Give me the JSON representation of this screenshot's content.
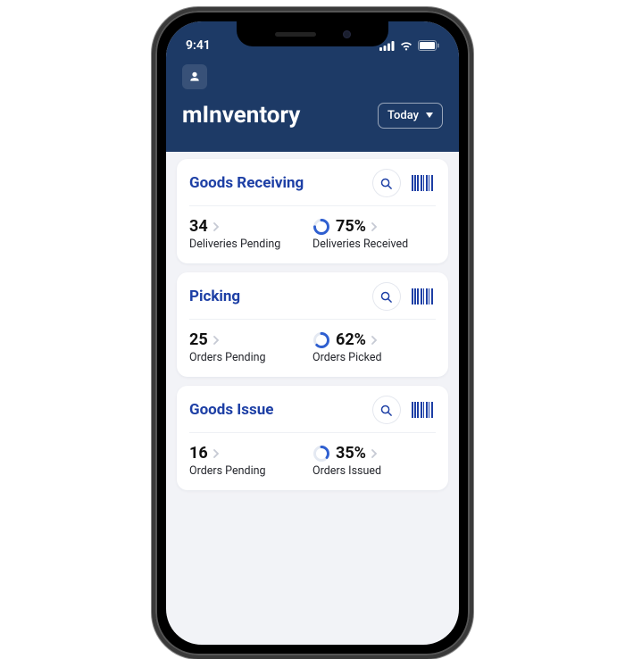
{
  "status": {
    "time": "9:41"
  },
  "header": {
    "app_title": "mInventory",
    "filter_label": "Today"
  },
  "cards": [
    {
      "title": "Goods Receiving",
      "left": {
        "value": "34",
        "label": "Deliveries Pending"
      },
      "right": {
        "value": "75%",
        "label": "Deliveries Received",
        "progress": 75
      }
    },
    {
      "title": "Picking",
      "left": {
        "value": "25",
        "label": "Orders Pending"
      },
      "right": {
        "value": "62%",
        "label": "Orders Picked",
        "progress": 62
      }
    },
    {
      "title": "Goods Issue",
      "left": {
        "value": "16",
        "label": "Orders Pending"
      },
      "right": {
        "value": "35%",
        "label": "Orders Issued",
        "progress": 35
      }
    }
  ]
}
